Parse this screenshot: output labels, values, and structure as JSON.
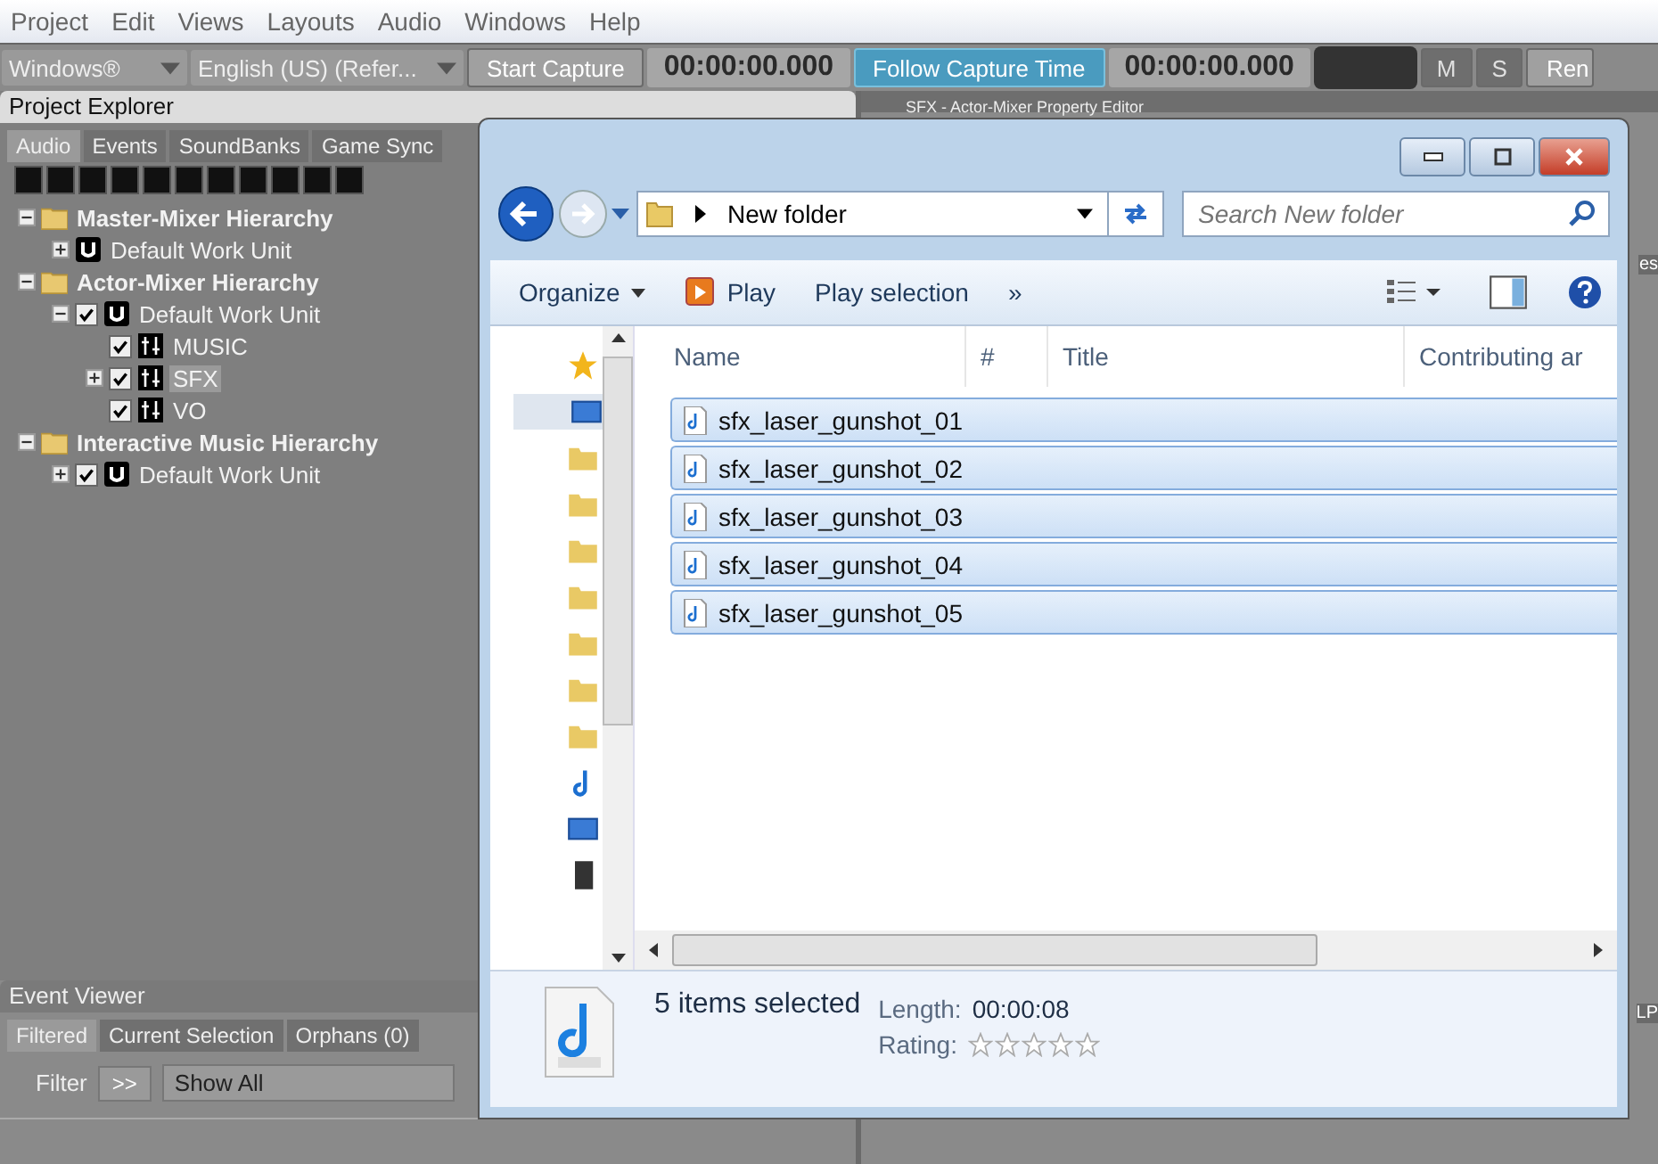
{
  "menu": [
    "Project",
    "Edit",
    "Views",
    "Layouts",
    "Audio",
    "Windows",
    "Help"
  ],
  "toolbar": {
    "platform": "Windows®",
    "language": "English (US) (Refer...",
    "start_capture": "Start Capture",
    "time_1": "00:00:00.000",
    "follow": {
      "label": "Follow Capture Time",
      "on": true
    },
    "time_2": "00:00:00.000",
    "mute": "M",
    "solo": "S",
    "cut_button": "Ren"
  },
  "project_explorer": {
    "title": "Project Explorer",
    "tabs": [
      {
        "label": "Audio",
        "selected": true
      },
      {
        "label": "Events",
        "selected": false
      },
      {
        "label": "SoundBanks",
        "selected": false
      },
      {
        "label": "Game Sync",
        "selected": false
      }
    ],
    "tree": [
      {
        "label": "Master-Mixer Hierarchy",
        "kind": "folder",
        "expanded": true,
        "selected": false,
        "children": [
          {
            "label": "Default Work Unit",
            "kind": "workunit",
            "expanded": false,
            "selected": false
          }
        ]
      },
      {
        "label": "Actor-Mixer Hierarchy",
        "kind": "folder",
        "expanded": true,
        "selected": false,
        "children": [
          {
            "label": "Default Work Unit",
            "kind": "workunit",
            "expanded": true,
            "checked": true,
            "selected": false,
            "children": [
              {
                "label": "MUSIC",
                "kind": "actor",
                "checked": true,
                "selected": false
              },
              {
                "label": "SFX",
                "kind": "actor",
                "expanded": false,
                "checked": true,
                "selected": true
              },
              {
                "label": "VO",
                "kind": "actor",
                "checked": true,
                "selected": false
              }
            ]
          }
        ]
      },
      {
        "label": "Interactive Music Hierarchy",
        "kind": "folder",
        "expanded": true,
        "selected": false,
        "children": [
          {
            "label": "Default Work Unit",
            "kind": "workunit",
            "expanded": false,
            "checked": true,
            "selected": false
          }
        ]
      }
    ]
  },
  "property_editor": {
    "title": "SFX - Actor-Mixer Property Editor",
    "fragments": [
      "es",
      "LP"
    ]
  },
  "event_viewer": {
    "title": "Event Viewer",
    "tabs": [
      {
        "label": "Filtered",
        "selected": true
      },
      {
        "label": "Current Selection",
        "selected": false
      },
      {
        "label": "Orphans (0)",
        "selected": false
      }
    ],
    "filter_label": "Filter",
    "filter_button": ">>",
    "filter_value": "Show All"
  },
  "explorer": {
    "path": "New folder",
    "search_placeholder": "Search New folder",
    "commands": [
      {
        "label": "Organize",
        "kind": "menu"
      },
      {
        "label": "Play",
        "kind": "play"
      },
      {
        "label": "Play selection",
        "kind": "plain"
      },
      {
        "label": "»",
        "kind": "plain"
      }
    ],
    "columns": [
      "Name",
      "#",
      "Title",
      "Contributing ar"
    ],
    "files": [
      {
        "name": "sfx_laser_gunshot_01",
        "selected": true
      },
      {
        "name": "sfx_laser_gunshot_02",
        "selected": true
      },
      {
        "name": "sfx_laser_gunshot_03",
        "selected": true
      },
      {
        "name": "sfx_laser_gunshot_04",
        "selected": true
      },
      {
        "name": "sfx_laser_gunshot_05",
        "selected": true
      }
    ],
    "details": {
      "summary": "5 items selected",
      "length_label": "Length:",
      "length": "00:00:08",
      "rating_label": "Rating:",
      "stars": 0
    }
  }
}
